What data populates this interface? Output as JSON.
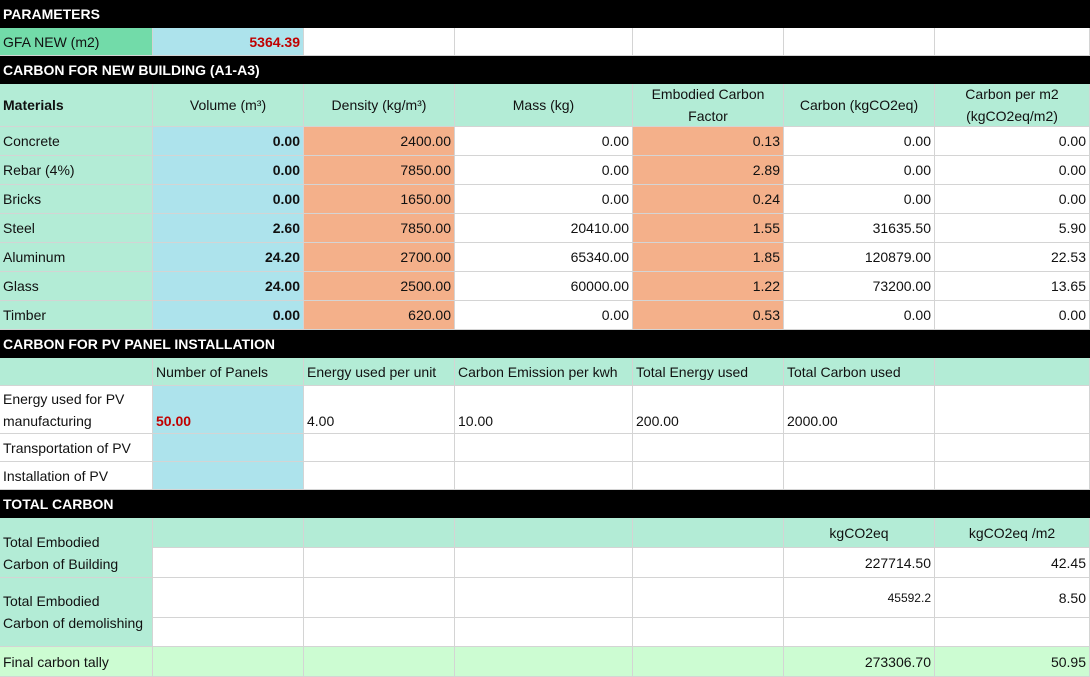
{
  "parameters": {
    "header": "PARAMETERS",
    "gfa_label": "GFA NEW (m2)",
    "gfa_value": "5364.39"
  },
  "new_building": {
    "header": "CARBON FOR NEW BUILDING (A1-A3)",
    "columns": [
      "Materials",
      "Volume (m³)",
      "Density (kg/m³)",
      "Mass (kg)",
      "Embodied Carbon Factor",
      "Carbon (kgCO2eq)",
      "Carbon per m2 (kgCO2eq/m2)"
    ],
    "rows": [
      {
        "material": "Concrete",
        "volume": "0.00",
        "density": "2400.00",
        "mass": "0.00",
        "factor": "0.13",
        "carbon": "0.00",
        "per_m2": "0.00"
      },
      {
        "material": "Rebar (4%)",
        "volume": "0.00",
        "density": "7850.00",
        "mass": "0.00",
        "factor": "2.89",
        "carbon": "0.00",
        "per_m2": "0.00"
      },
      {
        "material": "Bricks",
        "volume": "0.00",
        "density": "1650.00",
        "mass": "0.00",
        "factor": "0.24",
        "carbon": "0.00",
        "per_m2": "0.00"
      },
      {
        "material": "Steel",
        "volume": "2.60",
        "density": "7850.00",
        "mass": "20410.00",
        "factor": "1.55",
        "carbon": "31635.50",
        "per_m2": "5.90"
      },
      {
        "material": "Aluminum",
        "volume": "24.20",
        "density": "2700.00",
        "mass": "65340.00",
        "factor": "1.85",
        "carbon": "120879.00",
        "per_m2": "22.53"
      },
      {
        "material": "Glass",
        "volume": "24.00",
        "density": "2500.00",
        "mass": "60000.00",
        "factor": "1.22",
        "carbon": "73200.00",
        "per_m2": "13.65"
      },
      {
        "material": "Timber",
        "volume": "0.00",
        "density": "620.00",
        "mass": "0.00",
        "factor": "0.53",
        "carbon": "0.00",
        "per_m2": "0.00"
      }
    ]
  },
  "pv": {
    "header": "CARBON FOR PV PANEL INSTALLATION",
    "columns": [
      "Number of Panels",
      "Energy used per unit",
      "Carbon Emission per kwh",
      "Total Energy used",
      "Total Carbon used"
    ],
    "manufacturing_label": "Energy used for PV manufacturing",
    "panels": "50.00",
    "energy_per_unit": "4.00",
    "emission_per_kwh": "10.00",
    "total_energy": "200.00",
    "total_carbon": "2000.00",
    "transport_label": "Transportation of PV",
    "install_label": "Installation of PV"
  },
  "total": {
    "header": "TOTAL CARBON",
    "col_kg": "kgCO2eq",
    "col_kg_m2": "kgCO2eq /m2",
    "building_label": "Total Embodied Carbon of Building",
    "building_kg": "227714.50",
    "building_m2": "42.45",
    "demolish_label": "Total Embodied Carbon of demolishing",
    "demolish_kg": "45592.2",
    "demolish_m2": "8.50",
    "final_label": "Final carbon tally",
    "final_kg": "273306.70",
    "final_m2": "50.95"
  }
}
